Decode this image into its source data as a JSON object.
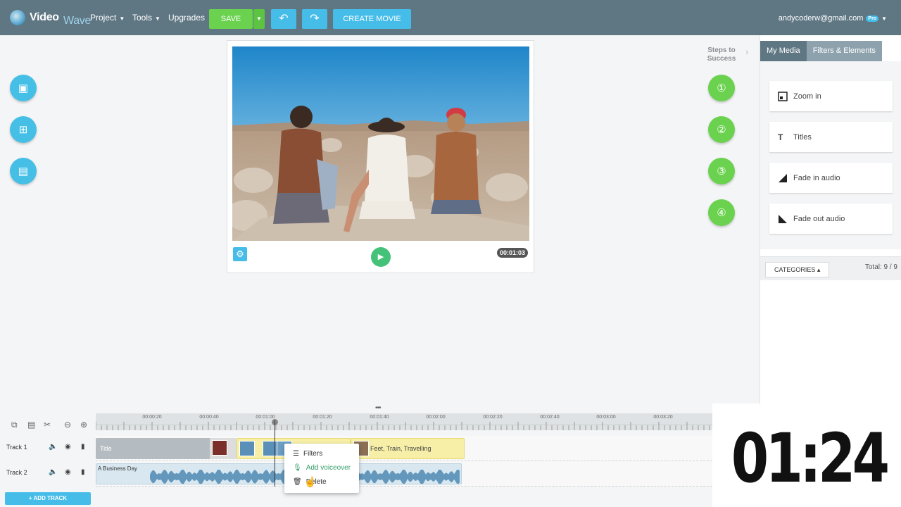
{
  "app": {
    "logo_video": "Video",
    "logo_wave": "Wave"
  },
  "menu": {
    "project": "Project",
    "tools": "Tools",
    "upgrades": "Upgrades"
  },
  "toolbar": {
    "save": "SAVE",
    "create_movie": "CREATE MOVIE"
  },
  "user": {
    "email": "andycoderw@gmail.com",
    "badge": "Pro"
  },
  "preview": {
    "timecode": "00:01:03"
  },
  "steps": {
    "title": "Steps to Success"
  },
  "right_panel": {
    "tabs": [
      "My Media",
      "Filters & Elements"
    ],
    "items": [
      {
        "label": "Zoom in",
        "icon": "zoom-icon"
      },
      {
        "label": "Titles",
        "icon": "titles-icon"
      },
      {
        "label": "Fade in audio",
        "icon": "fade-in-icon"
      },
      {
        "label": "Fade out audio",
        "icon": "fade-out-icon"
      }
    ],
    "categories_button": "CATEGORIES",
    "total": "Total: 9 / 9"
  },
  "timeline": {
    "ruler": [
      "00:00:20",
      "00:00:40",
      "00:01:00",
      "00:01:20",
      "00:01:40",
      "00:02:00",
      "00:02:20",
      "00:02:40",
      "00:03:00",
      "00:03:20"
    ],
    "tracks": [
      {
        "label": "Track 1",
        "title_clip": "Title",
        "clip_label": "Feet, Train, Travelling"
      },
      {
        "label": "Track 2",
        "audio_clip": "A Business Day"
      }
    ],
    "add_track": "ADD TRACK"
  },
  "context_menu": {
    "filters": "Filters",
    "add_voiceover": "Add voiceover",
    "delete": "Delete"
  },
  "overlay": {
    "timer": "01:24"
  },
  "colors": {
    "topbar": "#5f7683",
    "accent_blue": "#46bde9",
    "accent_green": "#6ad24e"
  }
}
